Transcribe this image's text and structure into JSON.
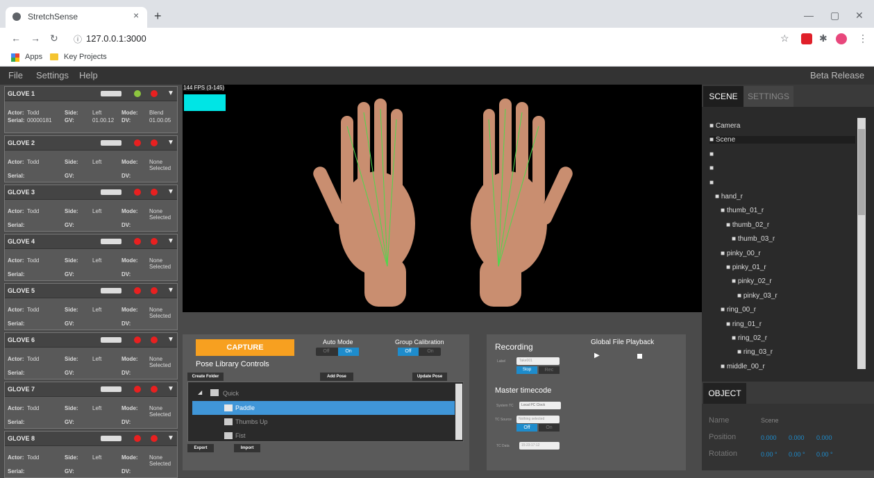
{
  "browser": {
    "tab_title": "StretchSense",
    "url_info": "ⓘ",
    "url": "127.0.0.1:3000",
    "bookmarks": [
      "Apps",
      "Key Projects"
    ]
  },
  "menu": {
    "items": [
      "File",
      "Settings",
      "Help"
    ],
    "beta": "Beta Release"
  },
  "gloves": [
    {
      "name": "GLOVE 1",
      "status_dot": "#8dc63f",
      "actor_label": "Actor:",
      "actor": "Todd",
      "side_label": "Side:",
      "side": "Left",
      "mode_label": "Mode:",
      "mode": "Blend",
      "serial_label": "Serial:",
      "serial": "00000181",
      "gv_label": "GV:",
      "gv": "01.00.12",
      "dv_label": "DV:",
      "dv": "01.00.05"
    },
    {
      "name": "GLOVE 2",
      "status_dot": "#e82020",
      "actor_label": "Actor:",
      "actor": "Todd",
      "side_label": "Side:",
      "side": "Left",
      "mode_label": "Mode:",
      "mode": "None Selected",
      "serial_label": "Serial:",
      "serial": "",
      "gv_label": "GV:",
      "gv": "",
      "dv_label": "DV:",
      "dv": ""
    },
    {
      "name": "GLOVE 3",
      "status_dot": "#e82020",
      "actor_label": "Actor:",
      "actor": "Todd",
      "side_label": "Side:",
      "side": "Left",
      "mode_label": "Mode:",
      "mode": "None Selected",
      "serial_label": "Serial:",
      "serial": "",
      "gv_label": "GV:",
      "gv": "",
      "dv_label": "DV:",
      "dv": ""
    },
    {
      "name": "GLOVE 4",
      "status_dot": "#e82020",
      "actor_label": "Actor:",
      "actor": "Todd",
      "side_label": "Side:",
      "side": "Left",
      "mode_label": "Mode:",
      "mode": "None Selected",
      "serial_label": "Serial:",
      "serial": "",
      "gv_label": "GV:",
      "gv": "",
      "dv_label": "DV:",
      "dv": ""
    },
    {
      "name": "GLOVE 5",
      "status_dot": "#e82020",
      "actor_label": "Actor:",
      "actor": "Todd",
      "side_label": "Side:",
      "side": "Left",
      "mode_label": "Mode:",
      "mode": "None Selected",
      "serial_label": "Serial:",
      "serial": "",
      "gv_label": "GV:",
      "gv": "",
      "dv_label": "DV:",
      "dv": ""
    },
    {
      "name": "GLOVE 6",
      "status_dot": "#e82020",
      "actor_label": "Actor:",
      "actor": "Todd",
      "side_label": "Side:",
      "side": "Left",
      "mode_label": "Mode:",
      "mode": "None Selected",
      "serial_label": "Serial:",
      "serial": "",
      "gv_label": "GV:",
      "gv": "",
      "dv_label": "DV:",
      "dv": ""
    },
    {
      "name": "GLOVE 7",
      "status_dot": "#e82020",
      "actor_label": "Actor:",
      "actor": "Todd",
      "side_label": "Side:",
      "side": "Left",
      "mode_label": "Mode:",
      "mode": "None Selected",
      "serial_label": "Serial:",
      "serial": "",
      "gv_label": "GV:",
      "gv": "",
      "dv_label": "DV:",
      "dv": ""
    },
    {
      "name": "GLOVE 8",
      "status_dot": "#e82020",
      "actor_label": "Actor:",
      "actor": "Todd",
      "side_label": "Side:",
      "side": "Left",
      "mode_label": "Mode:",
      "mode": "None Selected",
      "serial_label": "Serial:",
      "serial": "",
      "gv_label": "GV:",
      "gv": "",
      "dv_label": "DV:",
      "dv": ""
    }
  ],
  "viewport": {
    "fps": "144 FPS (3-145)"
  },
  "library": {
    "capture": "CAPTURE",
    "auto_mode": "Auto Mode",
    "group_calibration": "Group Calibration",
    "auto_off": "Off",
    "auto_on": "On",
    "group_off": "Off",
    "group_on": "On",
    "title": "Pose Library Controls",
    "create_folder": "Create Folder",
    "add_pose": "Add Pose",
    "update_pose": "Update Pose",
    "folder": "Quick",
    "poses": [
      "Paddle",
      "Thumbs Up",
      "Fist"
    ],
    "export": "Export",
    "import": "Import"
  },
  "recording": {
    "title": "Recording",
    "label_tag": "Label",
    "label_value": "Take001",
    "stop": "Stop",
    "rec": "Rec",
    "global_playback": "Global File Playback",
    "master_tc": "Master timecode",
    "system_tc_tag": "System TC",
    "system_tc_value": "Local PC Clock",
    "tc_source_tag": "TC Source",
    "tc_source_value": "Nothing selected",
    "tc_off": "Off",
    "tc_on": "On",
    "tc_data_tag": "TC Data",
    "tc_data_value": "15:23:17:12"
  },
  "scene": {
    "tab_scene": "SCENE",
    "tab_settings": "SETTINGS",
    "items": [
      "Camera",
      "Scene",
      "",
      "",
      "",
      "hand_r",
      "thumb_01_r",
      "thumb_02_r",
      "thumb_03_r",
      "pinky_00_r",
      "pinky_01_r",
      "pinky_02_r",
      "pinky_03_r",
      "ring_00_r",
      "ring_01_r",
      "ring_02_r",
      "ring_03_r",
      "middle_00_r"
    ]
  },
  "object": {
    "tab": "OBJECT",
    "name_label": "Name",
    "name_value": "Scene",
    "position_label": "Position",
    "position": [
      "0.000",
      "0.000",
      "0.000"
    ],
    "rotation_label": "Rotation",
    "rotation": [
      "0.00 °",
      "0.00 °",
      "0.00 °"
    ]
  }
}
